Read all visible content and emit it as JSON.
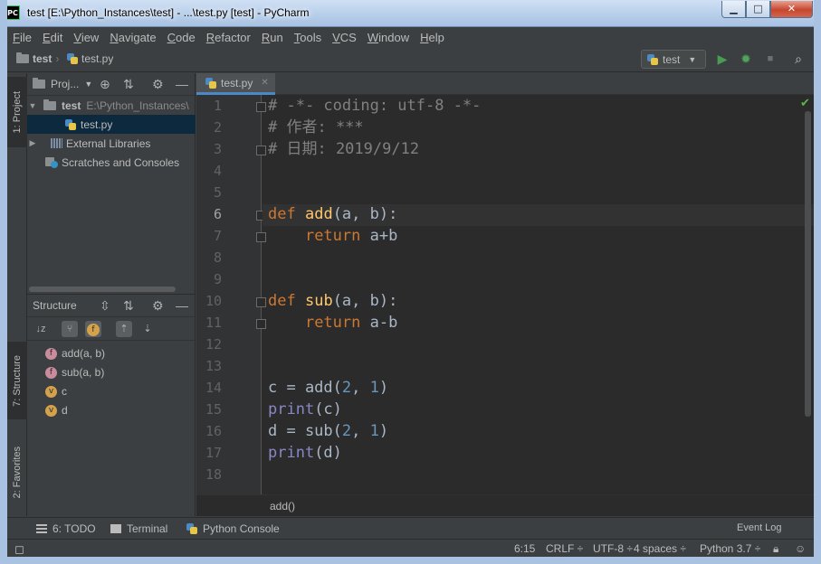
{
  "window": {
    "title": "test [E:\\Python_Instances\\test] - ...\\test.py [test] - PyCharm",
    "app_icon": "PC",
    "min": "▁",
    "max": "□",
    "close": "✕"
  },
  "menu": [
    "File",
    "Edit",
    "View",
    "Navigate",
    "Code",
    "Refactor",
    "Run",
    "Tools",
    "VCS",
    "Window",
    "Help"
  ],
  "navbar": {
    "project": "test",
    "file": "test.py",
    "run_config": "test"
  },
  "tool_stripe": {
    "project": "1: Project",
    "structure": "7: Structure",
    "favorites": "2: Favorites"
  },
  "project_panel": {
    "header": "Proj...",
    "root_name": "test",
    "root_path": "E:\\Python_Instances\\",
    "file": "test.py",
    "external_libraries": "External Libraries",
    "scratches": "Scratches and Consoles"
  },
  "structure_panel": {
    "header": "Structure",
    "items": [
      {
        "badge": "f",
        "label": "add(a, b)"
      },
      {
        "badge": "f",
        "label": "sub(a, b)"
      },
      {
        "badge": "v",
        "label": "c"
      },
      {
        "badge": "v",
        "label": "d"
      }
    ]
  },
  "editor": {
    "tab": "test.py",
    "current_line": 6,
    "line_numbers": [
      "1",
      "2",
      "3",
      "4",
      "5",
      "6",
      "7",
      "8",
      "9",
      "10",
      "11",
      "12",
      "13",
      "14",
      "15",
      "16",
      "17",
      "18"
    ],
    "breadcrumb": "add()"
  },
  "bottom_tools": {
    "todo": "6: TODO",
    "terminal": "Terminal",
    "python_console": "Python Console",
    "event_log": "Event Log"
  },
  "status": {
    "position": "6:15",
    "line_sep": "CRLF ÷",
    "encoding": "UTF-8 ÷",
    "indent": "4 spaces ÷",
    "interpreter": "Python 3.7 ÷"
  },
  "colors": {
    "keyword": "#cc7832",
    "function": "#ffc66d",
    "number": "#6897bb",
    "comment": "#808080",
    "builtin": "#8888c6",
    "text": "#a9b7c6"
  }
}
